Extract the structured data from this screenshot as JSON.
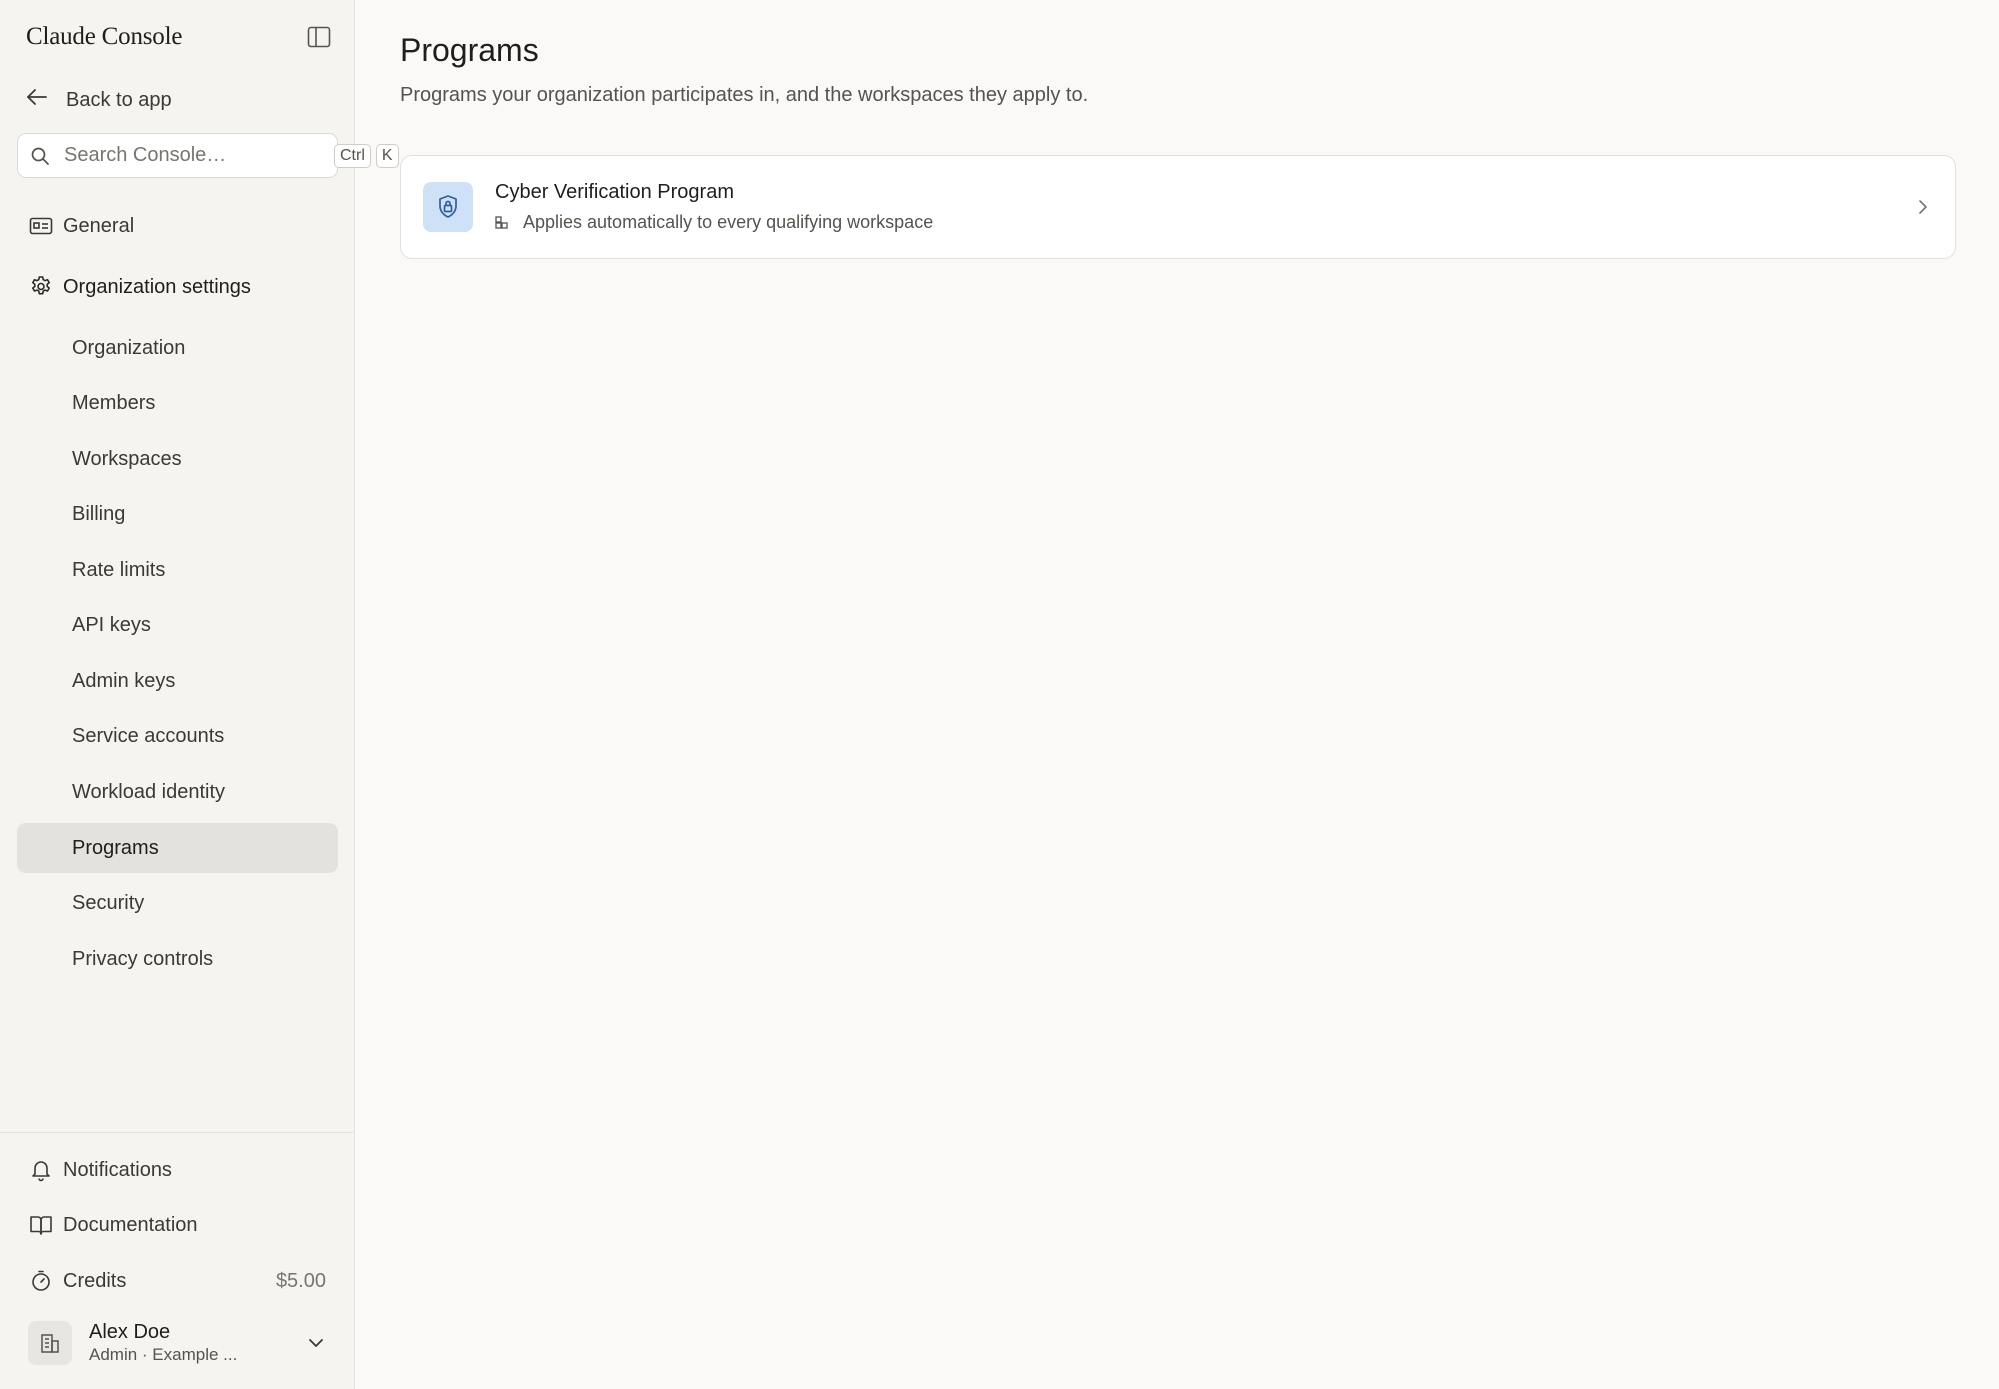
{
  "app": {
    "brand": "Claude Console"
  },
  "sidebar": {
    "back_label": "Back to app",
    "search": {
      "placeholder": "Search Console…",
      "shortcut_ctrl": "Ctrl",
      "shortcut_key": "K"
    },
    "general_label": "General",
    "org_settings_label": "Organization settings",
    "sub_items": [
      {
        "label": "Organization"
      },
      {
        "label": "Members"
      },
      {
        "label": "Workspaces"
      },
      {
        "label": "Billing"
      },
      {
        "label": "Rate limits"
      },
      {
        "label": "API keys"
      },
      {
        "label": "Admin keys"
      },
      {
        "label": "Service accounts"
      },
      {
        "label": "Workload identity"
      },
      {
        "label": "Programs",
        "active": true
      },
      {
        "label": "Security"
      },
      {
        "label": "Privacy controls"
      }
    ],
    "footer": {
      "notifications_label": "Notifications",
      "documentation_label": "Documentation",
      "credits_label": "Credits",
      "credits_value": "$5.00"
    },
    "user": {
      "name": "Alex Doe",
      "subtitle": "Admin · Example ..."
    }
  },
  "main": {
    "title": "Programs",
    "description": "Programs your organization participates in, and the workspaces they apply to.",
    "programs": [
      {
        "title": "Cyber Verification Program",
        "subtitle": "Applies automatically to every qualifying workspace"
      }
    ]
  },
  "colors": {
    "active_nav_bg": "#e4e2de",
    "program_icon_bg": "#cfe1f7",
    "program_icon_fg": "#2f5f9e"
  }
}
